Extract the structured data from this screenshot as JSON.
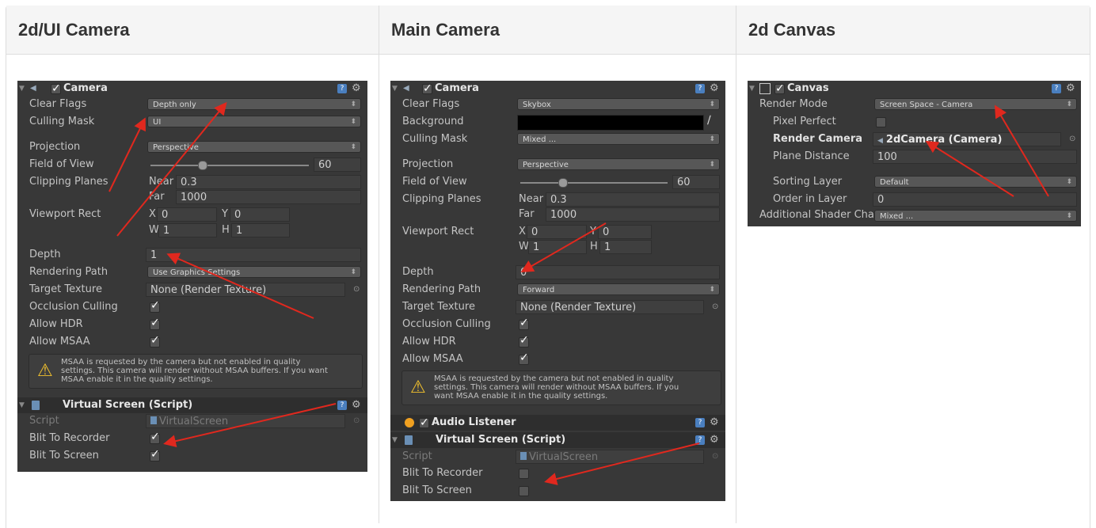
{
  "columns": {
    "col1": "2d/UI Camera",
    "col2": "Main Camera",
    "col3": "2d Canvas"
  },
  "common": {
    "camera": "Camera",
    "clear_flags": "Clear Flags",
    "background": "Background",
    "culling_mask": "Culling Mask",
    "projection": "Projection",
    "perspective": "Perspective",
    "fov": "Field of View",
    "fov_value": "60",
    "clipping": "Clipping Planes",
    "near": "Near",
    "near_value": "0.3",
    "far": "Far",
    "far_value": "1000",
    "viewport": "Viewport Rect",
    "x": "X",
    "y": "Y",
    "w": "W",
    "h": "H",
    "zero": "0",
    "one": "1",
    "depth": "Depth",
    "rendering_path": "Rendering Path",
    "target_texture": "Target Texture",
    "target_texture_value": "None (Render Texture)",
    "occlusion": "Occlusion Culling",
    "hdr": "Allow HDR",
    "msaa": "Allow MSAA",
    "warning": "MSAA is requested by the camera but not enabled in quality settings. This camera will render without MSAA buffers. If you want MSAA enable it in the quality settings.",
    "vs": "Virtual Screen (Script)",
    "script": "Script",
    "script_value": "VirtualScreen",
    "blit_recorder": "Blit To Recorder",
    "blit_screen": "Blit To Screen",
    "audio_listener": "Audio Listener"
  },
  "ui_camera": {
    "clear_flags_value": "Depth only",
    "culling_mask_value": "UI",
    "depth_value": "1",
    "rendering_path_value": "Use Graphics Settings",
    "warning_lines": [
      "MSAA is requested by the camera but not enabled in quality",
      "settings. This camera will render without MSAA buffers. If you want",
      "MSAA enable it in the quality settings."
    ]
  },
  "main_camera": {
    "clear_flags_value": "Skybox",
    "culling_mask_value": "Mixed ...",
    "depth_value": "0",
    "rendering_path_value": "Forward",
    "warning_lines": [
      "MSAA is requested by the camera but not enabled in quality",
      "settings. This camera will render without MSAA buffers. If you",
      "want MSAA enable it in the quality settings."
    ]
  },
  "canvas": {
    "title": "Canvas",
    "render_mode": "Render Mode",
    "render_mode_value": "Screen Space - Camera",
    "pixel_perfect": "Pixel Perfect",
    "render_camera": "Render Camera",
    "render_camera_value": "2dCamera (Camera)",
    "plane_distance": "Plane Distance",
    "plane_distance_value": "100",
    "sorting_layer": "Sorting Layer",
    "sorting_layer_value": "Default",
    "order_in_layer": "Order in Layer",
    "order_in_layer_value": "0",
    "additional_shader": "Additional Shader Cha",
    "additional_shader_value": "Mixed ..."
  },
  "colors": {
    "panel_bg": "#383838",
    "arrow": "#e0281e",
    "header_bg": "#f5f5f5"
  }
}
